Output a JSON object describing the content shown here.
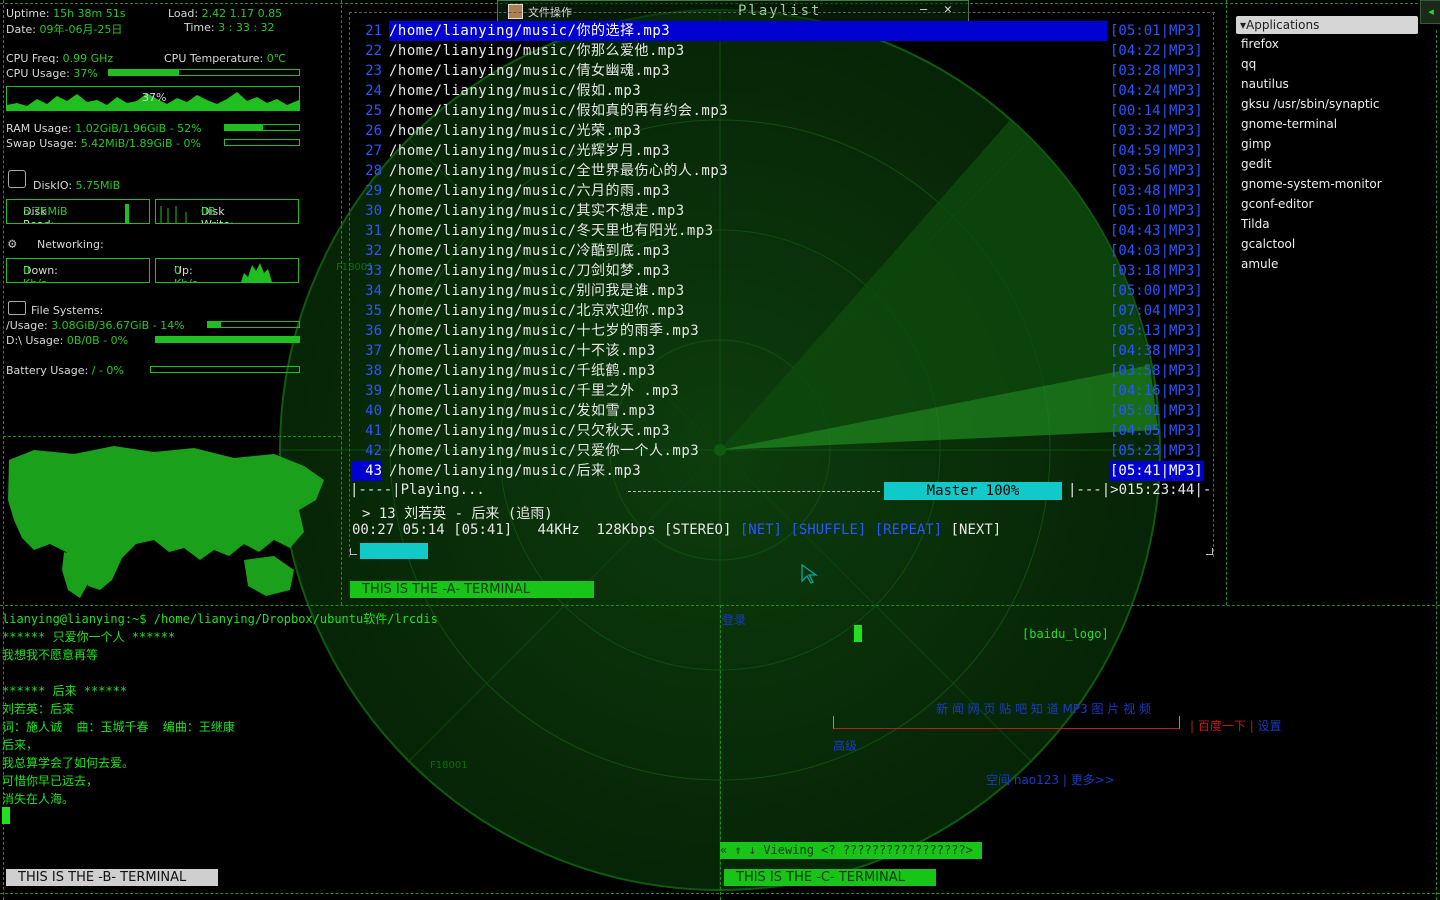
{
  "conky": {
    "uptime_label": "Uptime:",
    "uptime": "15h 38m 51s",
    "load_label": "Load:",
    "load": "2.42 1.17 0.85",
    "date_label": "Date:",
    "date": "09年-06月-25日",
    "time_label": "Time:",
    "time": "3 : 33 : 32",
    "cpu_freq_label": "CPU Freq:",
    "cpu_freq": "0.99 GHz",
    "cpu_temp_label": "CPU Temperature:",
    "cpu_temp": "0℃",
    "cpu_usage_label": "CPU Usage:",
    "cpu_usage": "37%",
    "cpu_usage_fraction": 0.37,
    "cpu_graph_label": "37%",
    "ram_label": "RAM Usage:",
    "ram": "1.02GiB/1.96GiB - 52%",
    "ram_fraction": 0.52,
    "swap_label": "Swap Usage:",
    "swap": "5.42MiB/1.89GiB - 0%",
    "swap_fraction": 0.0,
    "diskio_label": "DiskIO:",
    "diskio": "5.75MiB",
    "disk_read_label": "Disk Read:",
    "disk_read": "5.75MiB",
    "disk_write_label": "Disk Write:",
    "disk_write": "0B",
    "networking_label": "Networking:",
    "down_label": "Down:",
    "down": "0 Kb/s",
    "up_label": "Up:",
    "up": "0 Kb/s",
    "fs_label": "File Systems:",
    "root_label": "/Usage:",
    "root": "3.08GiB/36.67GiB - 14%",
    "root_fraction": 0.14,
    "d_label": "D:\\ Usage:",
    "d": "0B/0B - 0%",
    "d_fraction": 1.0,
    "battery_label": "Battery Usage:",
    "battery": "/ - 0%",
    "battery_fraction": 0.0
  },
  "radar": {
    "label1": "F18001",
    "label2": "F18001"
  },
  "playlist": {
    "window_app": "文件操作",
    "title": "Playlist",
    "minimize": "—",
    "close": "✕",
    "rows": [
      {
        "num": "21",
        "path": "/home/lianying/music/你的选择.mp3",
        "dur": "[05:01|MP3]"
      },
      {
        "num": "22",
        "path": "/home/lianying/music/你那么爱他.mp3",
        "dur": "[04:22|MP3]"
      },
      {
        "num": "23",
        "path": "/home/lianying/music/倩女幽魂.mp3",
        "dur": "[03:28|MP3]"
      },
      {
        "num": "24",
        "path": "/home/lianying/music/假如.mp3",
        "dur": "[04:24|MP3]"
      },
      {
        "num": "25",
        "path": "/home/lianying/music/假如真的再有约会.mp3",
        "dur": "[00:14|MP3]"
      },
      {
        "num": "26",
        "path": "/home/lianying/music/光荣.mp3",
        "dur": "[03:32|MP3]"
      },
      {
        "num": "27",
        "path": "/home/lianying/music/光辉岁月.mp3",
        "dur": "[04:59|MP3]"
      },
      {
        "num": "28",
        "path": "/home/lianying/music/全世界最伤心的人.mp3",
        "dur": "[03:56|MP3]"
      },
      {
        "num": "29",
        "path": "/home/lianying/music/六月的雨.mp3",
        "dur": "[03:48|MP3]"
      },
      {
        "num": "30",
        "path": "/home/lianying/music/其实不想走.mp3",
        "dur": "[05:10|MP3]"
      },
      {
        "num": "31",
        "path": "/home/lianying/music/冬天里也有阳光.mp3",
        "dur": "[04:43|MP3]"
      },
      {
        "num": "32",
        "path": "/home/lianying/music/冷酷到底.mp3",
        "dur": "[04:03|MP3]"
      },
      {
        "num": "33",
        "path": "/home/lianying/music/刀剑如梦.mp3",
        "dur": "[03:18|MP3]"
      },
      {
        "num": "34",
        "path": "/home/lianying/music/别问我是谁.mp3",
        "dur": "[05:00|MP3]"
      },
      {
        "num": "35",
        "path": "/home/lianying/music/北京欢迎你.mp3",
        "dur": "[07:04|MP3]"
      },
      {
        "num": "36",
        "path": "/home/lianying/music/十七岁的雨季.mp3",
        "dur": "[05:13|MP3]"
      },
      {
        "num": "37",
        "path": "/home/lianying/music/十不该.mp3",
        "dur": "[04:38|MP3]"
      },
      {
        "num": "38",
        "path": "/home/lianying/music/千纸鹤.mp3",
        "dur": "[03:58|MP3]"
      },
      {
        "num": "39",
        "path": "/home/lianying/music/千里之外 .mp3",
        "dur": "[04:16|MP3]"
      },
      {
        "num": "40",
        "path": "/home/lianying/music/发如雪.mp3",
        "dur": "[05:01|MP3]"
      },
      {
        "num": "41",
        "path": "/home/lianying/music/只欠秋天.mp3",
        "dur": "[04:05|MP3]"
      },
      {
        "num": "42",
        "path": "/home/lianying/music/只爱你一个人.mp3",
        "dur": "[05:23|MP3]"
      },
      {
        "num": "43",
        "path": "/home/lianying/music/后来.mp3",
        "dur": "[05:41|MP3]"
      }
    ],
    "status": "Playing...",
    "mixer": "Master 100%",
    "total_time": ">015:23:44",
    "now_playing": "> 13 刘若英 - 后来 (追雨)",
    "elapsed": "00:27",
    "remaining": "05:14",
    "length": "[05:41]",
    "khz": "44KHz",
    "kbps": "128Kbps",
    "stereo": "[STEREO]",
    "net": "[NET]",
    "shuffle": "[SHUFFLE]",
    "repeat": "[REPEAT]",
    "next": "[NEXT]",
    "progress_fraction": 0.08
  },
  "applications": {
    "title": "▾Applications",
    "items": [
      "firefox",
      "qq",
      "nautilus",
      "gksu /usr/sbin/synaptic",
      "gnome-terminal",
      "gimp",
      "gedit",
      "gnome-system-monitor",
      "gconf-editor",
      "Tilda",
      "gcalctool",
      "amule"
    ]
  },
  "terminal_a": {
    "label": "THIS IS THE -A- TERMINAL"
  },
  "terminal_b": {
    "label": "THIS IS THE -B- TERMINAL",
    "lines": [
      "lianying@lianying:~$ /home/lianying/Dropbox/ubuntu软件/lrcdis",
      "****** 只爱你一个人 ******",
      "我想我不愿意再等",
      "",
      "****** 后来 ******",
      "刘若英：后来",
      "词：施人诚  曲：玉城千春  编曲：王继康",
      "后来，",
      "我总算学会了如何去爱。",
      "可惜你早已远去，",
      "消失在人海。"
    ]
  },
  "terminal_c": {
    "label": "THIS IS THE -C- TERMINAL",
    "viewing": "« ↑ ↓ Viewing <? ?????????????????>"
  },
  "browser": {
    "top_link": "登录",
    "logo": "[baidu_logo]",
    "nav": "新 闻  网 页  贴 吧  知 道  MP3  图 片  视 频",
    "search_button": "百度一下",
    "settings": "设置",
    "advanced": "高级",
    "bottom1": "空间",
    "bottom2": "hao123",
    "bottom3": "更多>>"
  }
}
